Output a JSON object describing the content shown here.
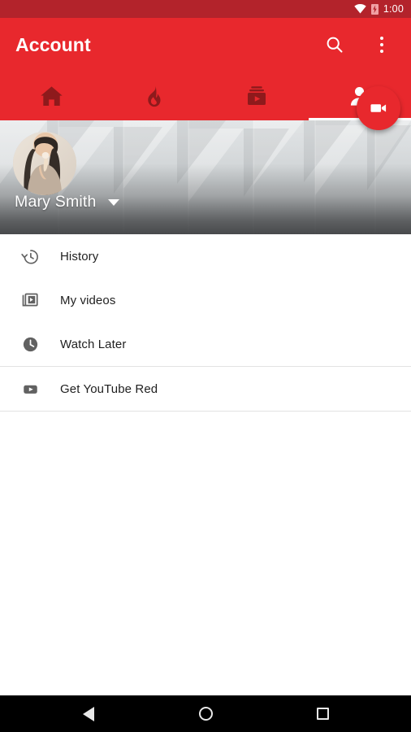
{
  "status_bar": {
    "time": "1:00",
    "wifi_icon": "wifi-icon",
    "battery_icon": "battery-charging-icon",
    "background": "#b3232b"
  },
  "app_bar": {
    "title": "Account",
    "background": "#e8282d",
    "search_icon": "search-icon",
    "overflow_icon": "overflow-menu-icon"
  },
  "tabs": [
    {
      "name": "home",
      "icon": "home-icon",
      "active": false
    },
    {
      "name": "trending",
      "icon": "flame-icon",
      "active": false
    },
    {
      "name": "subscriptions",
      "icon": "subscriptions-icon",
      "active": false
    },
    {
      "name": "account",
      "icon": "person-icon",
      "active": true
    }
  ],
  "banner": {
    "profile_name": "Mary Smith",
    "caret_icon": "chevron-down-icon",
    "avatar_icon": "user-avatar-photo",
    "fab": {
      "icon": "video-camera-icon",
      "color": "#e8282d"
    }
  },
  "menu": {
    "items": [
      {
        "label": "History",
        "icon": "history-icon"
      },
      {
        "label": "My videos",
        "icon": "my-videos-icon"
      },
      {
        "label": "Watch Later",
        "icon": "watch-later-icon"
      },
      {
        "label": "Get YouTube Red",
        "icon": "youtube-red-icon"
      }
    ]
  },
  "nav_bar": {
    "back_icon": "back-triangle-icon",
    "home_icon": "home-circle-icon",
    "recents_icon": "recents-square-icon"
  }
}
